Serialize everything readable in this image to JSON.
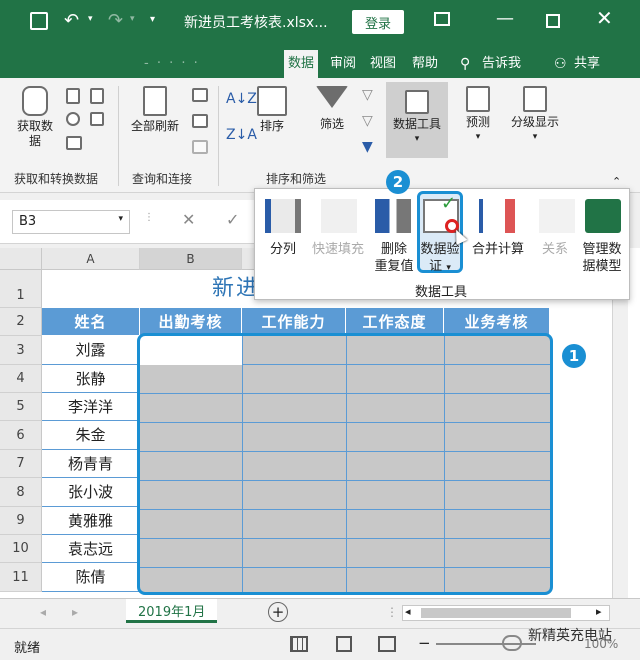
{
  "window": {
    "title": "新进员工考核表.xlsx...",
    "login_label": "登录"
  },
  "tabs": [
    {
      "label": "数据",
      "active": true
    },
    {
      "label": "审阅"
    },
    {
      "label": "视图"
    },
    {
      "label": "帮助"
    },
    {
      "label": "告诉我"
    },
    {
      "label": "共享"
    }
  ],
  "ribbon": {
    "get_data": "获取数\n据",
    "refresh_all": "全部刷新",
    "sort": "排序",
    "filter": "筛选",
    "data_tools": "数据工具",
    "forecast": "预测",
    "outline": "分级显示",
    "group_get_transform": "获取和转换数据",
    "group_queries": "查询和连接",
    "group_sort_filter": "排序和筛选"
  },
  "popup": {
    "text_to_columns": "分列",
    "flash_fill": "快速填充",
    "remove_duplicates": "删除\n重复值",
    "data_validation": "数据验\n证",
    "consolidate": "合并计算",
    "relationships": "关系",
    "manage_data_model": "管理数\n据模型",
    "group_label": "数据工具"
  },
  "formula_bar": {
    "name_box": "B3"
  },
  "columns": [
    "A",
    "B"
  ],
  "sheet": {
    "title": "新进员工考核表",
    "headers": [
      "姓名",
      "出勤考核",
      "工作能力",
      "工作态度",
      "业务考核"
    ],
    "rows": [
      {
        "num": "3",
        "name": "刘露"
      },
      {
        "num": "4",
        "name": "张静"
      },
      {
        "num": "5",
        "name": "李洋洋"
      },
      {
        "num": "6",
        "name": "朱金"
      },
      {
        "num": "7",
        "name": "杨青青"
      },
      {
        "num": "8",
        "name": "张小波"
      },
      {
        "num": "9",
        "name": "黄雅雅"
      },
      {
        "num": "10",
        "name": "袁志远"
      },
      {
        "num": "11",
        "name": "陈倩"
      }
    ]
  },
  "badges": {
    "one": "1",
    "two": "2"
  },
  "sheet_tab": "2019年1月",
  "status": {
    "ready": "就绪",
    "zoom": "100%",
    "watermark": "新精英充电站"
  },
  "colors": {
    "excel_green": "#217346",
    "header_blue": "#5b9bd5",
    "selection_gray": "#c8c8c8",
    "badge_blue": "#1a8fd3"
  }
}
